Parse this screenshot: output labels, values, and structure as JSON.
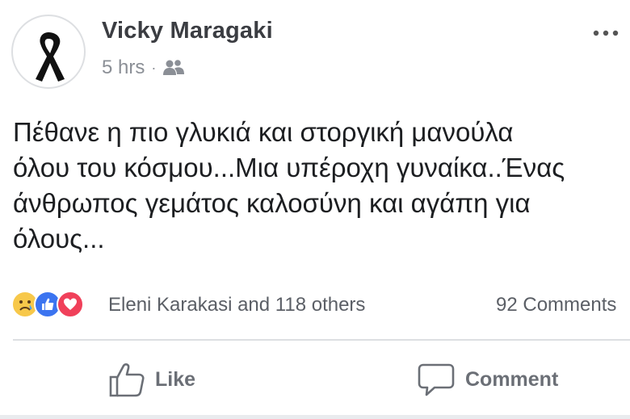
{
  "post": {
    "author": "Vicky Maragaki",
    "time": "5 hrs",
    "separator": "·",
    "audience_icon": "friends-icon",
    "avatar_icon": "black-mourning-ribbon-icon",
    "more_icon": "more-options-icon",
    "text_lines": [
      "Πέθανε η πιο γλυκιά και στοργική μανούλα",
      "όλου του κόσμου...Μια υπέροχη γυναίκα..Ένας",
      "άνθρωπος γεμάτος καλοσύνη και αγάπη για",
      "όλους..."
    ]
  },
  "reactions": {
    "icons": [
      "sad-reaction-icon",
      "like-reaction-icon",
      "love-reaction-icon"
    ],
    "names": "Eleni Karakasi and 118 others",
    "comments": "92 Comments"
  },
  "actions": {
    "like_label": "Like",
    "like_icon": "thumbs-up-icon",
    "comment_label": "Comment",
    "comment_icon": "comment-bubble-icon"
  },
  "colors": {
    "like_blue": "#3b74f0",
    "love_red": "#f0405a",
    "sad_yellow": "#f7c84a",
    "muted_text": "#6b6f76"
  }
}
